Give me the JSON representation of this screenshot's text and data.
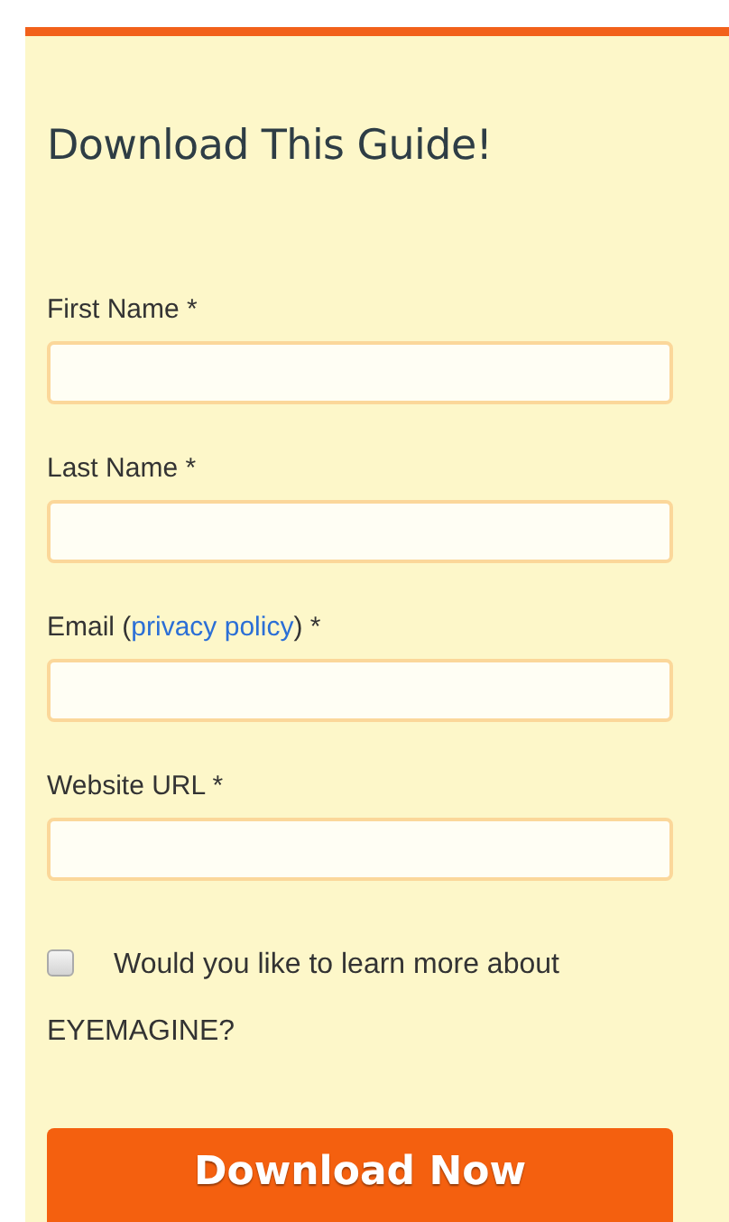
{
  "title": "Download This Guide!",
  "fields": [
    {
      "label": "First Name *"
    },
    {
      "label": "Last Name *"
    },
    {
      "label": "Email (",
      "link": "privacy policy",
      "after": ") *"
    },
    {
      "label": "Website URL *"
    }
  ],
  "opt_in": {
    "text": "Would you like to learn more about EYEMAGINE?",
    "checked": false
  },
  "button": "Download Now"
}
